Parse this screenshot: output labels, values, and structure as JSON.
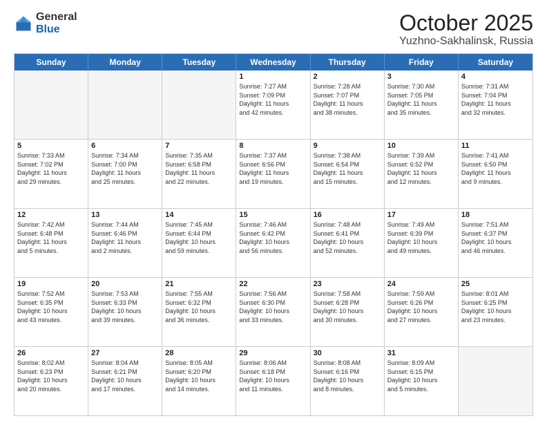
{
  "header": {
    "logo_general": "General",
    "logo_blue": "Blue",
    "month_title": "October 2025",
    "location": "Yuzhno-Sakhalinsk, Russia"
  },
  "days_of_week": [
    "Sunday",
    "Monday",
    "Tuesday",
    "Wednesday",
    "Thursday",
    "Friday",
    "Saturday"
  ],
  "rows": [
    [
      {
        "day": "",
        "lines": [],
        "empty": true
      },
      {
        "day": "",
        "lines": [],
        "empty": true
      },
      {
        "day": "",
        "lines": [],
        "empty": true
      },
      {
        "day": "1",
        "lines": [
          "Sunrise: 7:27 AM",
          "Sunset: 7:09 PM",
          "Daylight: 11 hours",
          "and 42 minutes."
        ]
      },
      {
        "day": "2",
        "lines": [
          "Sunrise: 7:28 AM",
          "Sunset: 7:07 PM",
          "Daylight: 11 hours",
          "and 38 minutes."
        ]
      },
      {
        "day": "3",
        "lines": [
          "Sunrise: 7:30 AM",
          "Sunset: 7:05 PM",
          "Daylight: 11 hours",
          "and 35 minutes."
        ]
      },
      {
        "day": "4",
        "lines": [
          "Sunrise: 7:31 AM",
          "Sunset: 7:04 PM",
          "Daylight: 11 hours",
          "and 32 minutes."
        ]
      }
    ],
    [
      {
        "day": "5",
        "lines": [
          "Sunrise: 7:33 AM",
          "Sunset: 7:02 PM",
          "Daylight: 11 hours",
          "and 29 minutes."
        ]
      },
      {
        "day": "6",
        "lines": [
          "Sunrise: 7:34 AM",
          "Sunset: 7:00 PM",
          "Daylight: 11 hours",
          "and 25 minutes."
        ]
      },
      {
        "day": "7",
        "lines": [
          "Sunrise: 7:35 AM",
          "Sunset: 6:58 PM",
          "Daylight: 11 hours",
          "and 22 minutes."
        ]
      },
      {
        "day": "8",
        "lines": [
          "Sunrise: 7:37 AM",
          "Sunset: 6:56 PM",
          "Daylight: 11 hours",
          "and 19 minutes."
        ]
      },
      {
        "day": "9",
        "lines": [
          "Sunrise: 7:38 AM",
          "Sunset: 6:54 PM",
          "Daylight: 11 hours",
          "and 15 minutes."
        ]
      },
      {
        "day": "10",
        "lines": [
          "Sunrise: 7:39 AM",
          "Sunset: 6:52 PM",
          "Daylight: 11 hours",
          "and 12 minutes."
        ]
      },
      {
        "day": "11",
        "lines": [
          "Sunrise: 7:41 AM",
          "Sunset: 6:50 PM",
          "Daylight: 11 hours",
          "and 9 minutes."
        ]
      }
    ],
    [
      {
        "day": "12",
        "lines": [
          "Sunrise: 7:42 AM",
          "Sunset: 6:48 PM",
          "Daylight: 11 hours",
          "and 5 minutes."
        ]
      },
      {
        "day": "13",
        "lines": [
          "Sunrise: 7:44 AM",
          "Sunset: 6:46 PM",
          "Daylight: 11 hours",
          "and 2 minutes."
        ]
      },
      {
        "day": "14",
        "lines": [
          "Sunrise: 7:45 AM",
          "Sunset: 6:44 PM",
          "Daylight: 10 hours",
          "and 59 minutes."
        ]
      },
      {
        "day": "15",
        "lines": [
          "Sunrise: 7:46 AM",
          "Sunset: 6:42 PM",
          "Daylight: 10 hours",
          "and 56 minutes."
        ]
      },
      {
        "day": "16",
        "lines": [
          "Sunrise: 7:48 AM",
          "Sunset: 6:41 PM",
          "Daylight: 10 hours",
          "and 52 minutes."
        ]
      },
      {
        "day": "17",
        "lines": [
          "Sunrise: 7:49 AM",
          "Sunset: 6:39 PM",
          "Daylight: 10 hours",
          "and 49 minutes."
        ]
      },
      {
        "day": "18",
        "lines": [
          "Sunrise: 7:51 AM",
          "Sunset: 6:37 PM",
          "Daylight: 10 hours",
          "and 46 minutes."
        ]
      }
    ],
    [
      {
        "day": "19",
        "lines": [
          "Sunrise: 7:52 AM",
          "Sunset: 6:35 PM",
          "Daylight: 10 hours",
          "and 43 minutes."
        ]
      },
      {
        "day": "20",
        "lines": [
          "Sunrise: 7:53 AM",
          "Sunset: 6:33 PM",
          "Daylight: 10 hours",
          "and 39 minutes."
        ]
      },
      {
        "day": "21",
        "lines": [
          "Sunrise: 7:55 AM",
          "Sunset: 6:32 PM",
          "Daylight: 10 hours",
          "and 36 minutes."
        ]
      },
      {
        "day": "22",
        "lines": [
          "Sunrise: 7:56 AM",
          "Sunset: 6:30 PM",
          "Daylight: 10 hours",
          "and 33 minutes."
        ]
      },
      {
        "day": "23",
        "lines": [
          "Sunrise: 7:58 AM",
          "Sunset: 6:28 PM",
          "Daylight: 10 hours",
          "and 30 minutes."
        ]
      },
      {
        "day": "24",
        "lines": [
          "Sunrise: 7:59 AM",
          "Sunset: 6:26 PM",
          "Daylight: 10 hours",
          "and 27 minutes."
        ]
      },
      {
        "day": "25",
        "lines": [
          "Sunrise: 8:01 AM",
          "Sunset: 6:25 PM",
          "Daylight: 10 hours",
          "and 23 minutes."
        ]
      }
    ],
    [
      {
        "day": "26",
        "lines": [
          "Sunrise: 8:02 AM",
          "Sunset: 6:23 PM",
          "Daylight: 10 hours",
          "and 20 minutes."
        ]
      },
      {
        "day": "27",
        "lines": [
          "Sunrise: 8:04 AM",
          "Sunset: 6:21 PM",
          "Daylight: 10 hours",
          "and 17 minutes."
        ]
      },
      {
        "day": "28",
        "lines": [
          "Sunrise: 8:05 AM",
          "Sunset: 6:20 PM",
          "Daylight: 10 hours",
          "and 14 minutes."
        ]
      },
      {
        "day": "29",
        "lines": [
          "Sunrise: 8:06 AM",
          "Sunset: 6:18 PM",
          "Daylight: 10 hours",
          "and 11 minutes."
        ]
      },
      {
        "day": "30",
        "lines": [
          "Sunrise: 8:08 AM",
          "Sunset: 6:16 PM",
          "Daylight: 10 hours",
          "and 8 minutes."
        ]
      },
      {
        "day": "31",
        "lines": [
          "Sunrise: 8:09 AM",
          "Sunset: 6:15 PM",
          "Daylight: 10 hours",
          "and 5 minutes."
        ]
      },
      {
        "day": "",
        "lines": [],
        "empty": true
      }
    ]
  ]
}
